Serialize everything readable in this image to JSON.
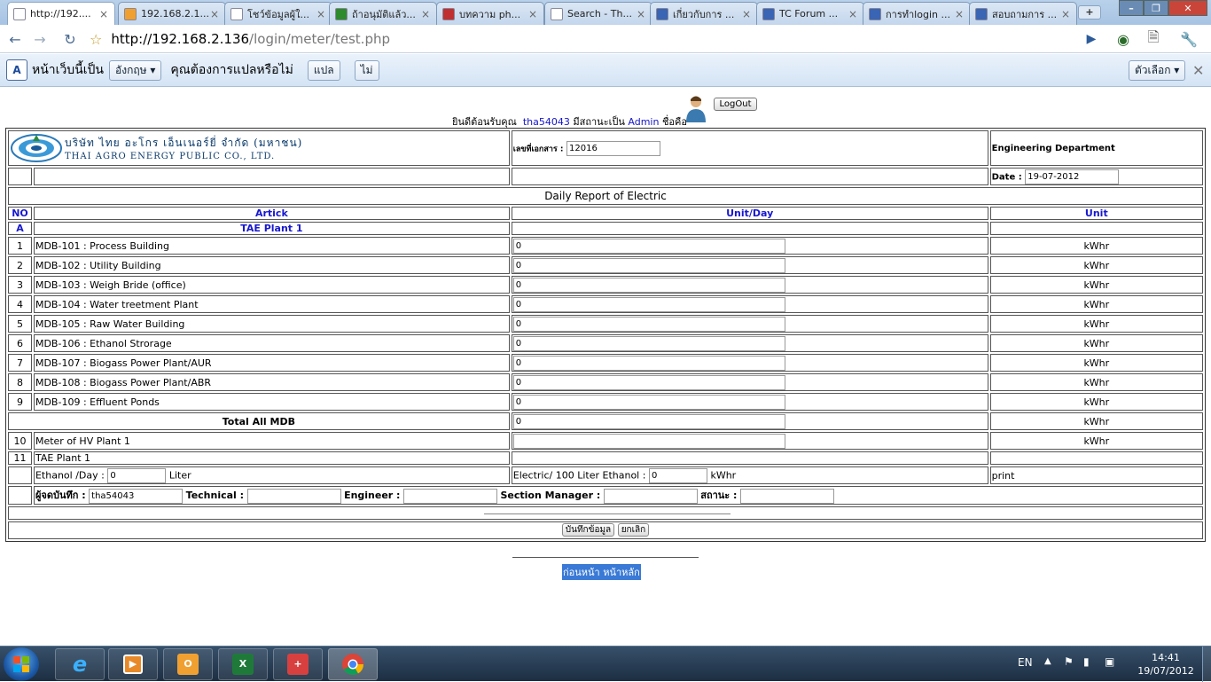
{
  "tabs": [
    {
      "title": "http://192....",
      "fav": "page-icon",
      "color": "#ffffff"
    },
    {
      "title": "192.168.2.1...",
      "fav": "pma-icon",
      "color": "#f0a030"
    },
    {
      "title": "โชว์ข้อมูลผู้ใ...",
      "fav": "page-icon",
      "color": "#ffffff"
    },
    {
      "title": "ถ้าอนุมัติแล้ว...",
      "fav": "google-icon",
      "color": "#2d8a2d"
    },
    {
      "title": "บทความ ph...",
      "fav": "flag-icon",
      "color": "#c03030"
    },
    {
      "title": "Search - Th...",
      "fav": "page-icon",
      "color": "#ffffff"
    },
    {
      "title": "เกี่ยวกับการ ...",
      "fav": "forum-icon",
      "color": "#3a64b4"
    },
    {
      "title": "TC Forum ...",
      "fav": "forum-icon",
      "color": "#3a64b4"
    },
    {
      "title": "การทำlogin ...",
      "fav": "forum-icon",
      "color": "#3a64b4"
    },
    {
      "title": "สอบถามการ ...",
      "fav": "forum-icon",
      "color": "#3a64b4"
    }
  ],
  "url": {
    "host": "http://192.168.2.136",
    "path": "/login/meter/test.php"
  },
  "translate_bar": {
    "prefix": "หน้าเว็บนี้เป็น",
    "language": "อังกฤษ",
    "question": "คุณต้องการแปลหรือไม่",
    "translate": "แปล",
    "no": "ไม่",
    "options": "ตัวเลือก"
  },
  "welcome": {
    "greet": "ยินดีต้อนรับคุณ",
    "user": "tha54043",
    "status_label": "มีสถานะเป็น",
    "role": "Admin",
    "suffix": "ชื่อคือ",
    "logout": "LogOut"
  },
  "company": {
    "thai": "บริษัท ไทย อะโกร เอ็นเนอร์ยี่ จำกัด (มหาชน)",
    "english": "THAI AGRO ENERGY PUBLIC CO., LTD."
  },
  "doc": {
    "no_label": "เลขที่เอกสาร :",
    "no_value": "12016",
    "department": "Engineering Department",
    "date_label": "Date :",
    "date_value": "19-07-2012"
  },
  "report_title": "Daily Report of Electric",
  "headers": {
    "no": "NO",
    "artick": "Artick",
    "unit_day": "Unit/Day",
    "unit": "Unit"
  },
  "section": {
    "no": "A",
    "name": "TAE Plant 1"
  },
  "rows": [
    {
      "no": "1",
      "name": "MDB-101 : Process Building",
      "value": "0",
      "unit": "kWhr"
    },
    {
      "no": "2",
      "name": "MDB-102 : Utility Building",
      "value": "0",
      "unit": "kWhr"
    },
    {
      "no": "3",
      "name": "MDB-103 : Weigh Bride (office)",
      "value": "0",
      "unit": "kWhr"
    },
    {
      "no": "4",
      "name": "MDB-104 : Water treetment Plant",
      "value": "0",
      "unit": "kWhr"
    },
    {
      "no": "5",
      "name": "MDB-105 : Raw Water Building",
      "value": "0",
      "unit": "kWhr"
    },
    {
      "no": "6",
      "name": "MDB-106 : Ethanol Strorage",
      "value": "0",
      "unit": "kWhr"
    },
    {
      "no": "7",
      "name": "MDB-107 : Biogass Power Plant/AUR",
      "value": "0",
      "unit": "kWhr"
    },
    {
      "no": "8",
      "name": "MDB-108 : Biogass Power Plant/ABR",
      "value": "0",
      "unit": "kWhr"
    },
    {
      "no": "9",
      "name": "MDB-109 : Effluent Ponds",
      "value": "0",
      "unit": "kWhr"
    }
  ],
  "total": {
    "label": "Total All MDB",
    "value": "0",
    "unit": "kWhr"
  },
  "row10": {
    "no": "10",
    "name": "Meter of HV Plant 1",
    "value": "",
    "unit": "kWhr"
  },
  "row11": {
    "no": "11",
    "name": "TAE Plant 1"
  },
  "ethanol": {
    "label": "Ethanol /Day :",
    "value": "0",
    "unit": "Liter",
    "elec_label": "Electric/ 100 Liter Ethanol :",
    "elec_value": "0",
    "elec_unit": "kWhr",
    "print": "print"
  },
  "signers": {
    "recorder_label": "ผู้จดบันทึก :",
    "recorder_value": "tha54043",
    "technical": "Technical :",
    "engineer": "Engineer :",
    "manager": "Section Manager :",
    "status": "สถานะ :"
  },
  "buttons": {
    "save": "บันทึกข้อมูล",
    "cancel": "ยกเลิก"
  },
  "footer": {
    "prev": "ก่อนหน้า",
    "home": "หน้าหลัก"
  },
  "clock": {
    "time": "14:41",
    "date": "19/07/2012",
    "lang": "EN"
  }
}
